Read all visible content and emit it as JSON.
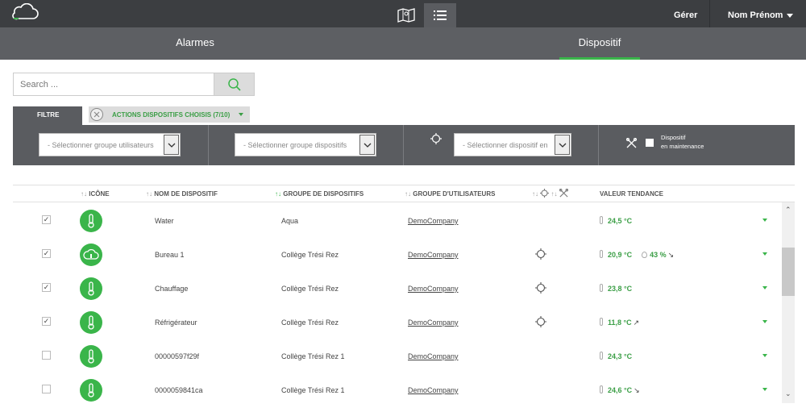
{
  "topbar": {
    "manage_label": "Gérer",
    "user_name": "Nom Prénom"
  },
  "tabs": [
    {
      "label": "Alarmes",
      "active": false
    },
    {
      "label": "Dispositif",
      "active": true
    }
  ],
  "search": {
    "placeholder": "Search ...",
    "value": ""
  },
  "filter": {
    "tab_label": "FILTRE",
    "actions_label": "ACTIONS DISPOSITIFS CHOISIS (7/10)",
    "user_group_select": "- Sélectionner groupe utilisateurs",
    "device_group_select": "- Sélectionner groupe dispositifs",
    "device_select": "- Sélectionner dispositif en",
    "maintenance_label_1": "Dispositif",
    "maintenance_label_2": "en maintenance"
  },
  "table": {
    "headers": {
      "icon": "ICÔNE",
      "name": "NOM DE DISPOSITIF",
      "device_group": "GROUPE DE DISPOSITIFS",
      "user_group": "GROUPE D'UTILISATEURS",
      "trend": "VALEUR TENDANCE"
    },
    "rows": [
      {
        "checked": "✓",
        "icon": "thermometer-icon",
        "name": "Water",
        "device_group": "Aqua",
        "user_group": "DemoCompany",
        "located": false,
        "value": "24,5 °C",
        "trend": "",
        "humidity": ""
      },
      {
        "checked": "✓",
        "icon": "cloud-icon",
        "name": "Bureau 1",
        "device_group": "Collège Trési Rez",
        "user_group": "DemoCompany",
        "located": true,
        "value": "20,9 °C",
        "trend": "",
        "humidity": "43 %",
        "humidity_trend": "↘"
      },
      {
        "checked": "✓",
        "icon": "thermometer-icon",
        "name": "Chauffage",
        "device_group": "Collège Trési Rez",
        "user_group": "DemoCompany",
        "located": true,
        "value": "23,8 °C",
        "trend": "",
        "humidity": ""
      },
      {
        "checked": "✓",
        "icon": "thermometer-icon",
        "name": "Réfrigérateur",
        "device_group": "Collège Trési Rez",
        "user_group": "DemoCompany",
        "located": true,
        "value": "11,8 °C",
        "trend": "↗",
        "humidity": ""
      },
      {
        "checked": "",
        "icon": "thermometer-icon",
        "name": "00000597f29f",
        "device_group": "Collège Trési Rez 1",
        "user_group": "DemoCompany",
        "located": false,
        "value": "24,3 °C",
        "trend": "",
        "humidity": ""
      },
      {
        "checked": "",
        "icon": "thermometer-icon",
        "name": "0000059841ca",
        "device_group": "Collège Trési Rez 1",
        "user_group": "DemoCompany",
        "located": false,
        "value": "24,6 °C",
        "trend": "↘",
        "humidity": ""
      }
    ]
  },
  "colors": {
    "accent": "#3ab54a",
    "topbar": "#3c3e41",
    "tabbar": "#5d5f63"
  }
}
